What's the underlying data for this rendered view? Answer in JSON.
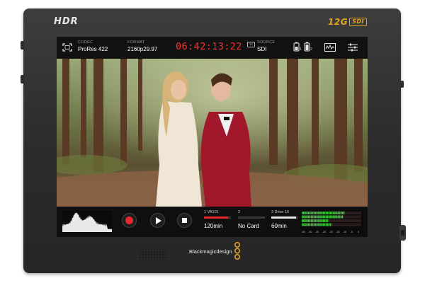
{
  "device": {
    "hdr_logo": "HDR",
    "sdi_logo_number": "12G",
    "sdi_logo_text": "SDI",
    "brand_name": "Blackmagicdesign"
  },
  "topbar": {
    "codec_label": "CODEC",
    "codec_value": "ProRes 422",
    "format_label": "FORMAT",
    "format_value": "2160p29.97",
    "timecode": "06:42:13:22",
    "tc_badge": "TC",
    "source_label": "SOURCE",
    "source_value": "SDI",
    "battery_1_label": "1",
    "battery_2_label": "2",
    "icons": [
      "fullscreen-icon",
      "battery-icon",
      "waveform-scope-icon",
      "settings-sliders-icon"
    ]
  },
  "transport": {
    "icons": [
      "record-icon",
      "play-icon",
      "stop-icon"
    ]
  },
  "media": [
    {
      "slot": "1",
      "name": "VA101",
      "time": "120min",
      "fill": 0.9,
      "color": "#e8262e"
    },
    {
      "slot": "2",
      "name": "",
      "time": "No Card",
      "fill": 0,
      "color": "#3a3a3a"
    },
    {
      "slot": "3",
      "name": "Drive 16",
      "time": "60min",
      "fill": 0.92,
      "color": "#e6e6e6"
    }
  ],
  "audio_meters": {
    "scale_labels": [
      "-50",
      "-40",
      "-30",
      "-25",
      "-20",
      "-15",
      "-10",
      "-5",
      "0"
    ],
    "levels": [
      0.72,
      0.7,
      0.45,
      0.5
    ]
  }
}
